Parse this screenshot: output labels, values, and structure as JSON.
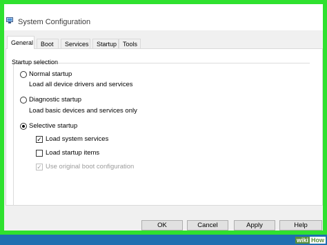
{
  "window": {
    "title": "System Configuration"
  },
  "tabs": [
    {
      "label": "General",
      "active": true
    },
    {
      "label": "Boot",
      "active": false
    },
    {
      "label": "Services",
      "active": false
    },
    {
      "label": "Startup",
      "active": false
    },
    {
      "label": "Tools",
      "active": false
    }
  ],
  "startup_selection": {
    "group_label": "Startup selection",
    "options": [
      {
        "label": "Normal startup",
        "description": "Load all device drivers and services",
        "selected": false
      },
      {
        "label": "Diagnostic startup",
        "description": "Load basic devices and services only",
        "selected": false
      },
      {
        "label": "Selective startup",
        "selected": true
      }
    ],
    "selective_items": [
      {
        "label": "Load system services",
        "checked": true,
        "enabled": true
      },
      {
        "label": "Load startup items",
        "checked": false,
        "enabled": true
      },
      {
        "label": "Use original boot configuration",
        "checked": true,
        "enabled": false
      }
    ]
  },
  "buttons": {
    "ok": "OK",
    "cancel": "Cancel",
    "apply": "Apply",
    "help": "Help"
  },
  "watermark": {
    "part1": "wiki",
    "part2": "How"
  },
  "colors": {
    "frame_highlight": "#2fe12f",
    "taskbar": "#1f6fb0"
  }
}
